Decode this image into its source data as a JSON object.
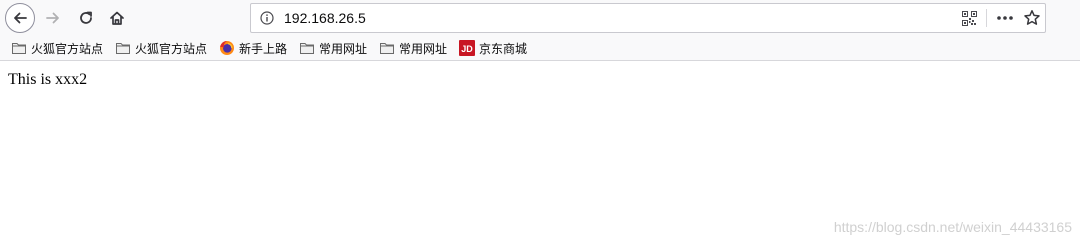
{
  "toolbar": {
    "url": "192.168.26.5",
    "icons": [
      "back-arrow-icon",
      "forward-arrow-icon",
      "reload-icon",
      "home-icon",
      "info-icon",
      "qr-code-icon",
      "more-dots-icon",
      "star-icon"
    ]
  },
  "bookmarks": [
    {
      "label": "火狐官方站点",
      "icon": "folder-icon"
    },
    {
      "label": "火狐官方站点",
      "icon": "folder-icon"
    },
    {
      "label": "新手上路",
      "icon": "firefox-icon"
    },
    {
      "label": "常用网址",
      "icon": "folder-icon"
    },
    {
      "label": "常用网址",
      "icon": "folder-icon"
    },
    {
      "label": "京东商城",
      "icon": "jd-icon",
      "icon_text": "JD"
    }
  ],
  "content": {
    "text": "This is xxx2"
  },
  "watermark": "https://blog.csdn.net/weixin_44433165",
  "colors": {
    "toolbar_bg": "#f9f9fa",
    "jd_red": "#c81623",
    "disabled_arrow": "#b1b1b3"
  }
}
